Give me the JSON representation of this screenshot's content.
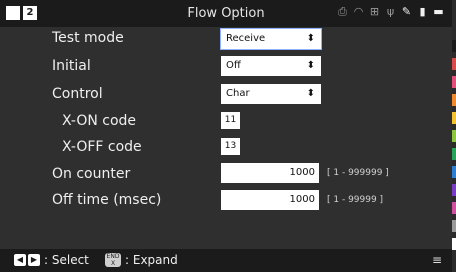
{
  "window": {
    "title": "Flow Option",
    "page_number": "2"
  },
  "status_icons": [
    "printer-icon",
    "wifi-icon",
    "network-icon",
    "usb-icon",
    "tool-icon",
    "sd-card-icon",
    "battery-icon"
  ],
  "form": {
    "test_mode": {
      "label": "Test mode",
      "value": "Receive"
    },
    "initial": {
      "label": "Initial",
      "value": "Off"
    },
    "control": {
      "label": "Control",
      "value": "Char"
    },
    "xon": {
      "label": "X-ON code",
      "value": "11"
    },
    "xoff": {
      "label": "X-OFF code",
      "value": "13"
    },
    "on_counter": {
      "label": "On counter",
      "value": "1000",
      "range": "[ 1 - 999999 ]"
    },
    "off_time": {
      "label": "Off time (msec)",
      "value": "1000",
      "range": "[ 1 - 99999 ]"
    }
  },
  "bottom": {
    "select_label": ": Select",
    "expand_label": ": Expand",
    "end_key_top": "END",
    "end_key_bottom": "X"
  },
  "strip_colors": [
    "#1a1a1a",
    "#d94a4a",
    "#e24f7a",
    "#f08a2c",
    "#f2c233",
    "#8cc63f",
    "#2aa35a",
    "#2c7fd0",
    "#7a3cc2",
    "#d04fa0",
    "#9a9a9a",
    "#ffffff"
  ]
}
